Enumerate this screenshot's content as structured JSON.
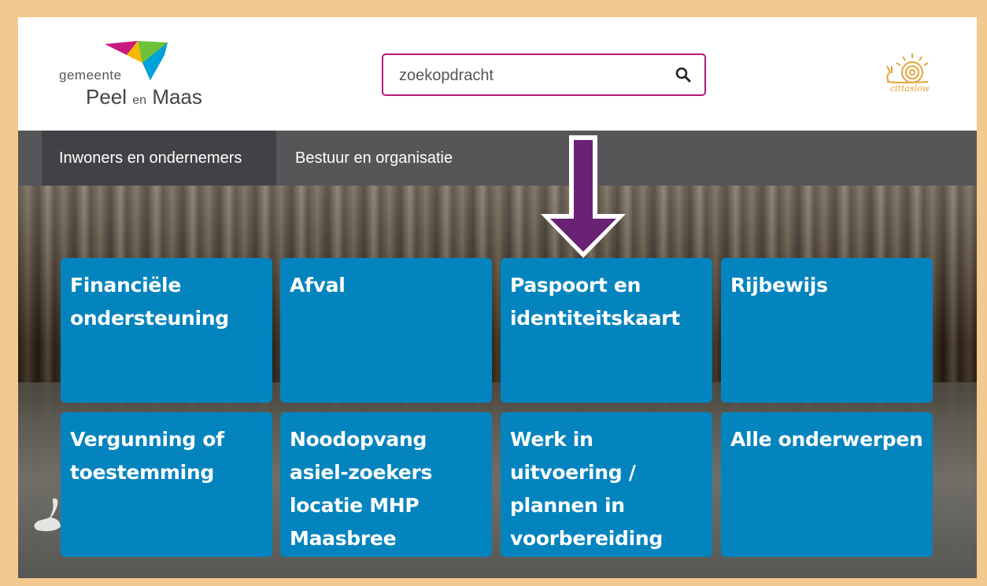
{
  "header": {
    "logo": {
      "small_text": "gemeente",
      "name_first": "Peel",
      "name_middle": "en",
      "name_last": "Maas",
      "colors": [
        "#c8197f",
        "#f5b800",
        "#6fc13a",
        "#00a2d8"
      ]
    },
    "search": {
      "placeholder": "zoekopdracht",
      "icon": "search-icon"
    },
    "partner_logo": {
      "label": "cittaslow",
      "icon": "snail-icon",
      "color": "#e8a33a"
    }
  },
  "nav": {
    "items": [
      {
        "label": "Inwoners en ondernemers",
        "active": true
      },
      {
        "label": "Bestuur en organisatie",
        "active": false
      }
    ]
  },
  "tiles": [
    {
      "label": "Financiële ondersteuning"
    },
    {
      "label": "Afval"
    },
    {
      "label": "Paspoort en identiteitskaart"
    },
    {
      "label": "Rijbewijs"
    },
    {
      "label": "Vergunning of toestemming"
    },
    {
      "label": "Noodopvang asiel-zoekers locatie MHP Maasbree"
    },
    {
      "label": "Werk in uitvoering / plannen in voorbereiding"
    },
    {
      "label": "Alle onderwerpen"
    }
  ],
  "annotation": {
    "icon": "down-arrow-icon",
    "color": "#6a2374"
  },
  "colors": {
    "tile": "#0384be",
    "nav": "#565659",
    "nav_active": "#424246",
    "frame": "#f4c98f",
    "search_border": "#b0197a"
  }
}
